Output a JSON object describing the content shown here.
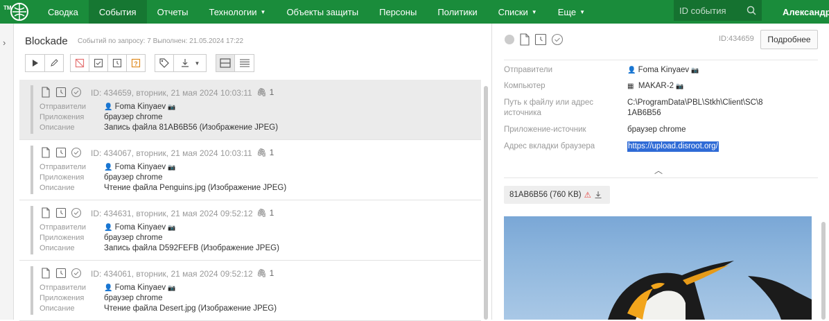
{
  "nav": {
    "logo_text": "TM",
    "items": [
      "Сводка",
      "События",
      "Отчеты",
      "Технологии",
      "Объекты защиты",
      "Персоны",
      "Политики",
      "Списки",
      "Еще"
    ],
    "search_placeholder": "ID события",
    "user": "Александр"
  },
  "list": {
    "title": "Blockade",
    "meta": "Событий по запросу: 7 Выполнен: 21.05.2024 17:22",
    "labels": {
      "senders": "Отправители",
      "apps": "Приложения",
      "desc": "Описание"
    },
    "events": [
      {
        "head": "ID: 434659, вторник, 21 мая 2024 10:03:11",
        "attachments": "1",
        "sender": "Foma Kinyaev",
        "app": "браузер chrome",
        "desc": "Запись файла 81AB6B56 (Изображение JPEG)"
      },
      {
        "head": "ID: 434067, вторник, 21 мая 2024 10:03:11",
        "attachments": "1",
        "sender": "Foma Kinyaev",
        "app": "браузер chrome",
        "desc": "Чтение файла Penguins.jpg (Изображение JPEG)"
      },
      {
        "head": "ID: 434631, вторник, 21 мая 2024 09:52:12",
        "attachments": "1",
        "sender": "Foma Kinyaev",
        "app": "браузер chrome",
        "desc": "Запись файла D592FEFB (Изображение JPEG)"
      },
      {
        "head": "ID: 434061, вторник, 21 мая 2024 09:52:12",
        "attachments": "1",
        "sender": "Foma Kinyaev",
        "app": "браузер chrome",
        "desc": "Чтение файла Desert.jpg (Изображение JPEG)"
      }
    ]
  },
  "detail": {
    "id": "ID:434659",
    "more_button": "Подробнее",
    "fields": {
      "senders_label": "Отправители",
      "senders_value": "Foma Kinyaev",
      "computer_label": "Компьютер",
      "computer_value": "MAKAR-2",
      "path_label_1": "Путь к файлу или адрес",
      "path_label_2": "источника",
      "path_value_1": "C:\\ProgramData\\PBL\\Stkh\\Client\\SC\\8",
      "path_value_2": "1AB6B56",
      "source_app_label": "Приложение-источник",
      "source_app_value": "браузер chrome",
      "tab_label": "Адрес вкладки браузера",
      "tab_value": "https://upload.disroot.org/"
    },
    "file_chip": "81AB6B56 (760 KB)"
  },
  "colors": {
    "brand": "#1a8c3b",
    "link_highlight": "#2f6bd6",
    "warning": "#e53935"
  }
}
